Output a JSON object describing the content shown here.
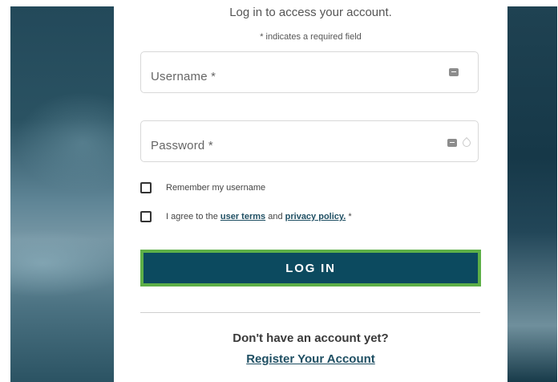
{
  "login": {
    "heading": "Log in to access your account.",
    "required_note": "* indicates a required field",
    "username_label": "Username *",
    "password_label": "Password *",
    "remember_label": "Remember my username",
    "agree_prefix": "I agree to the",
    "user_terms_link": "user terms",
    "agree_and": "and",
    "privacy_link": "privacy policy.",
    "agree_suffix": "*",
    "login_button": "LOG IN",
    "no_account": "Don't have an account yet?",
    "register_link": "Register Your Account",
    "icons": {
      "username": "password-manager-key-icon",
      "password": "password-manager-key-icon",
      "reveal": "show-password-eye-icon"
    },
    "colors": {
      "button_bg": "#0c4a5f",
      "button_border": "#5daf47",
      "link": "#1f4f63"
    }
  }
}
